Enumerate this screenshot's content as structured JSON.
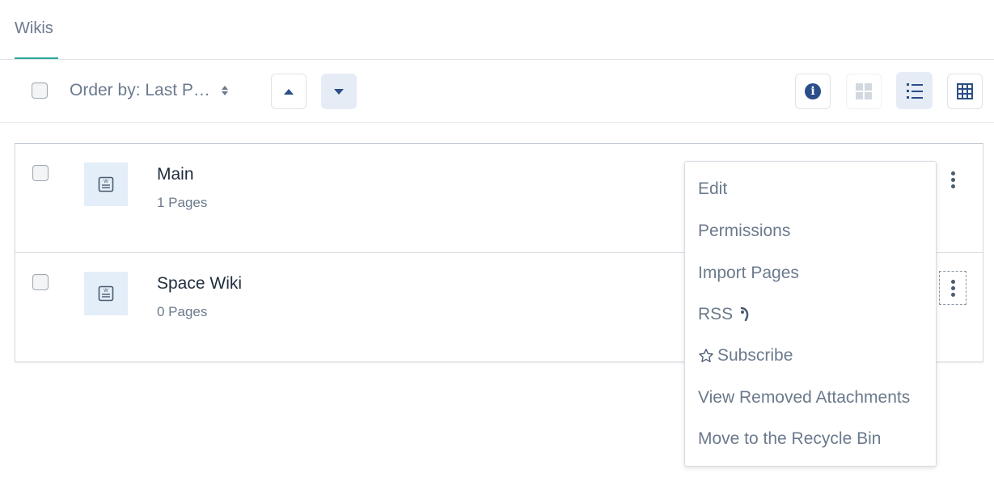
{
  "tabs": {
    "active": "Wikis"
  },
  "toolbar": {
    "order_label": "Order by: Last P…",
    "sort_asc_icon": "triangle-up-icon",
    "sort_desc_icon": "triangle-down-icon",
    "info_glyph": "i",
    "views": [
      "info",
      "grid",
      "list",
      "table"
    ]
  },
  "wikis": [
    {
      "title": "Main",
      "count": "1 Pages"
    },
    {
      "title": "Space Wiki",
      "count": "0 Pages"
    }
  ],
  "menu": {
    "edit": "Edit",
    "permissions": "Permissions",
    "import": "Import Pages",
    "rss": "RSS",
    "subscribe": "Subscribe",
    "removed_attachments": "View Removed Attachments",
    "recycle": "Move to the Recycle Bin"
  },
  "colors": {
    "accent": "#27a99a",
    "primary": "#2b4e88",
    "icon_bg": "#e4eef8"
  }
}
